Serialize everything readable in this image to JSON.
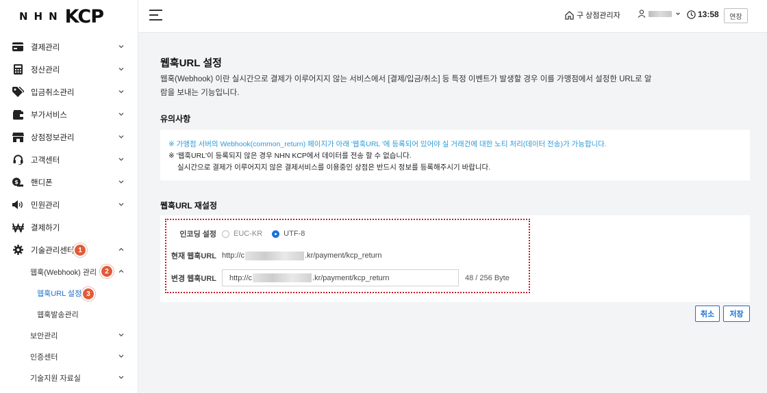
{
  "brand": {
    "nhn": "NHN",
    "kcp": "KCP"
  },
  "header": {
    "old_admin": "구 상점관리자",
    "time": "13:58",
    "extend": "연장"
  },
  "sidebar": {
    "items": [
      {
        "label": "결제관리",
        "icon": "card-icon"
      },
      {
        "label": "정산관리",
        "icon": "calculator-icon"
      },
      {
        "label": "입금취소관리",
        "icon": "tag-icon"
      },
      {
        "label": "부가서비스",
        "icon": "wallet-icon"
      },
      {
        "label": "상점정보관리",
        "icon": "store-icon"
      },
      {
        "label": "고객센터",
        "icon": "headset-icon"
      },
      {
        "label": "핸디폰",
        "icon": "handphone-icon"
      },
      {
        "label": "민원관리",
        "icon": "speaker-icon"
      },
      {
        "label": "결제하기",
        "icon": "won-icon"
      },
      {
        "label": "기술관리센터",
        "icon": "gear-icon"
      }
    ],
    "tech_sub": [
      {
        "label": "웹훅(Webhook) 관리"
      },
      {
        "label": "웹훅URL 설정"
      },
      {
        "label": "웹훅발송관리"
      },
      {
        "label": "보안관리"
      },
      {
        "label": "인증센터"
      },
      {
        "label": "기술지원 자료실"
      }
    ],
    "badges": [
      "1",
      "2",
      "3"
    ]
  },
  "main": {
    "title": "웹훅URL 설정",
    "desc": "웹훅(Webhook) 이란 실시간으로 결제가 이루어지지 않는 서비스에서 [결제/입금/취소] 등 특정 이벤트가 발생할 경우 이를 가맹점에서 설정한 URL로 알람을 보내는 기능입니다.",
    "notice_title": "유의사항",
    "notice": {
      "line1": "※ 가맹점 서버의 Webhook(common_return) 페이지가 아래 '웹훅URL '에 등록되어 있어야 실 거래건에 대한 노티 처리(데이터 전송)가 가능합니다.",
      "line2": "※ '웹훅URL'이 등록되지 않은 경우 NHN KCP에서 데이터를 전송 할 수 없습니다.",
      "line3": "실시간으로 결제가 이루어지지 않은 결제서비스를 이용중인 상점은 반드시 정보를 등록해주시기 바랍니다."
    },
    "reset_title": "웹훅URL 재설정",
    "form": {
      "encoding_label": "인코딩 설정",
      "enc_euc": "EUC-KR",
      "enc_utf": "UTF-8",
      "current_label": "현재 웹훅URL",
      "current_prefix": "http://c",
      "current_suffix": ".kr/payment/kcp_return",
      "change_label": "변경 웹훅URL",
      "change_prefix": "http://c",
      "change_suffix": ".kr/payment/kcp_return",
      "byte_count": "48 / 256 Byte"
    },
    "cancel": "취소",
    "save": "저장"
  },
  "colors": {
    "accent": "#1a6fd1",
    "badge": "#e05c3a",
    "notice_blue": "#2a9ad8",
    "highlight": "#c0192a"
  }
}
